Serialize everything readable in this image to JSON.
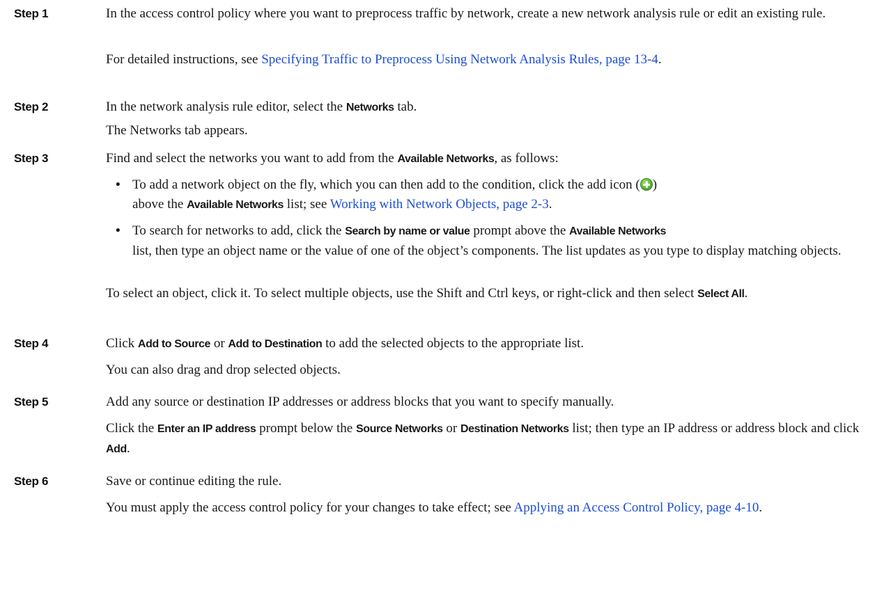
{
  "steps": [
    {
      "label": "Step 1",
      "text": "In the access control policy where you want to preprocess traffic by network, create a new network analysis rule or edit an existing rule.",
      "note_prefix": "For detailed instructions, see ",
      "note_link": "Specifying Traffic to Preprocess Using Network Analysis Rules, page 13-4",
      "note_suffix": "."
    },
    {
      "label": "Step 2",
      "pre": "In the network analysis rule editor, select the ",
      "ui": "Networks",
      "post": " tab.",
      "note": "The Networks tab appears."
    },
    {
      "label": "Step 3",
      "pre": "Find and select the networks you want to add from the ",
      "ui": "Available Networks",
      "post": ", as follows:",
      "bullets": [
        {
          "t1": "To add a network object on the fly, which you can then add to the condition, click the add icon (",
          "icon": "add-icon",
          "t2": ")",
          "t3": "above the ",
          "ui": "Available Networks",
          "t4": " list; see ",
          "link": "Working with Network Objects, page 2-3",
          "t5": "."
        },
        {
          "t1": "To search for networks to add, click the ",
          "ui1": "Search by name or value",
          "t2": " prompt above the ",
          "ui2": "Available Networks",
          "t3": "list, then type an object name or the value of one of the object’s components. The list updates as you type to display matching objects."
        }
      ],
      "after_pre": "To select an object, click it. To select multiple objects, use the Shift and Ctrl keys, or right-click and then select ",
      "after_ui": "Select All",
      "after_post": "."
    },
    {
      "label": "Step 4",
      "pre": "Click ",
      "ui1": "Add to Source",
      "mid": " or ",
      "ui2": "Add to Destination",
      "post": " to add the selected objects to the appropriate list.",
      "note": "You can also drag and drop selected objects."
    },
    {
      "label": "Step 5",
      "text": "Add any source or destination IP addresses or address blocks that you want to specify manually.",
      "n_pre": "Click the ",
      "n_ui1": "Enter an IP address",
      "n_mid1": " prompt below the ",
      "n_ui2": "Source Networks",
      "n_mid2": " or ",
      "n_ui3": "Destination Networks",
      "n_post": " list; then type an IP address or address block and click ",
      "n_ui4": "Add",
      "n_end": "."
    },
    {
      "label": "Step 6",
      "text": "Save or continue editing the rule.",
      "note_prefix": "You must apply the access control policy for your changes to take effect; see ",
      "note_link": "Applying an Access Control Policy, page 4-10",
      "note_suffix": "."
    }
  ]
}
